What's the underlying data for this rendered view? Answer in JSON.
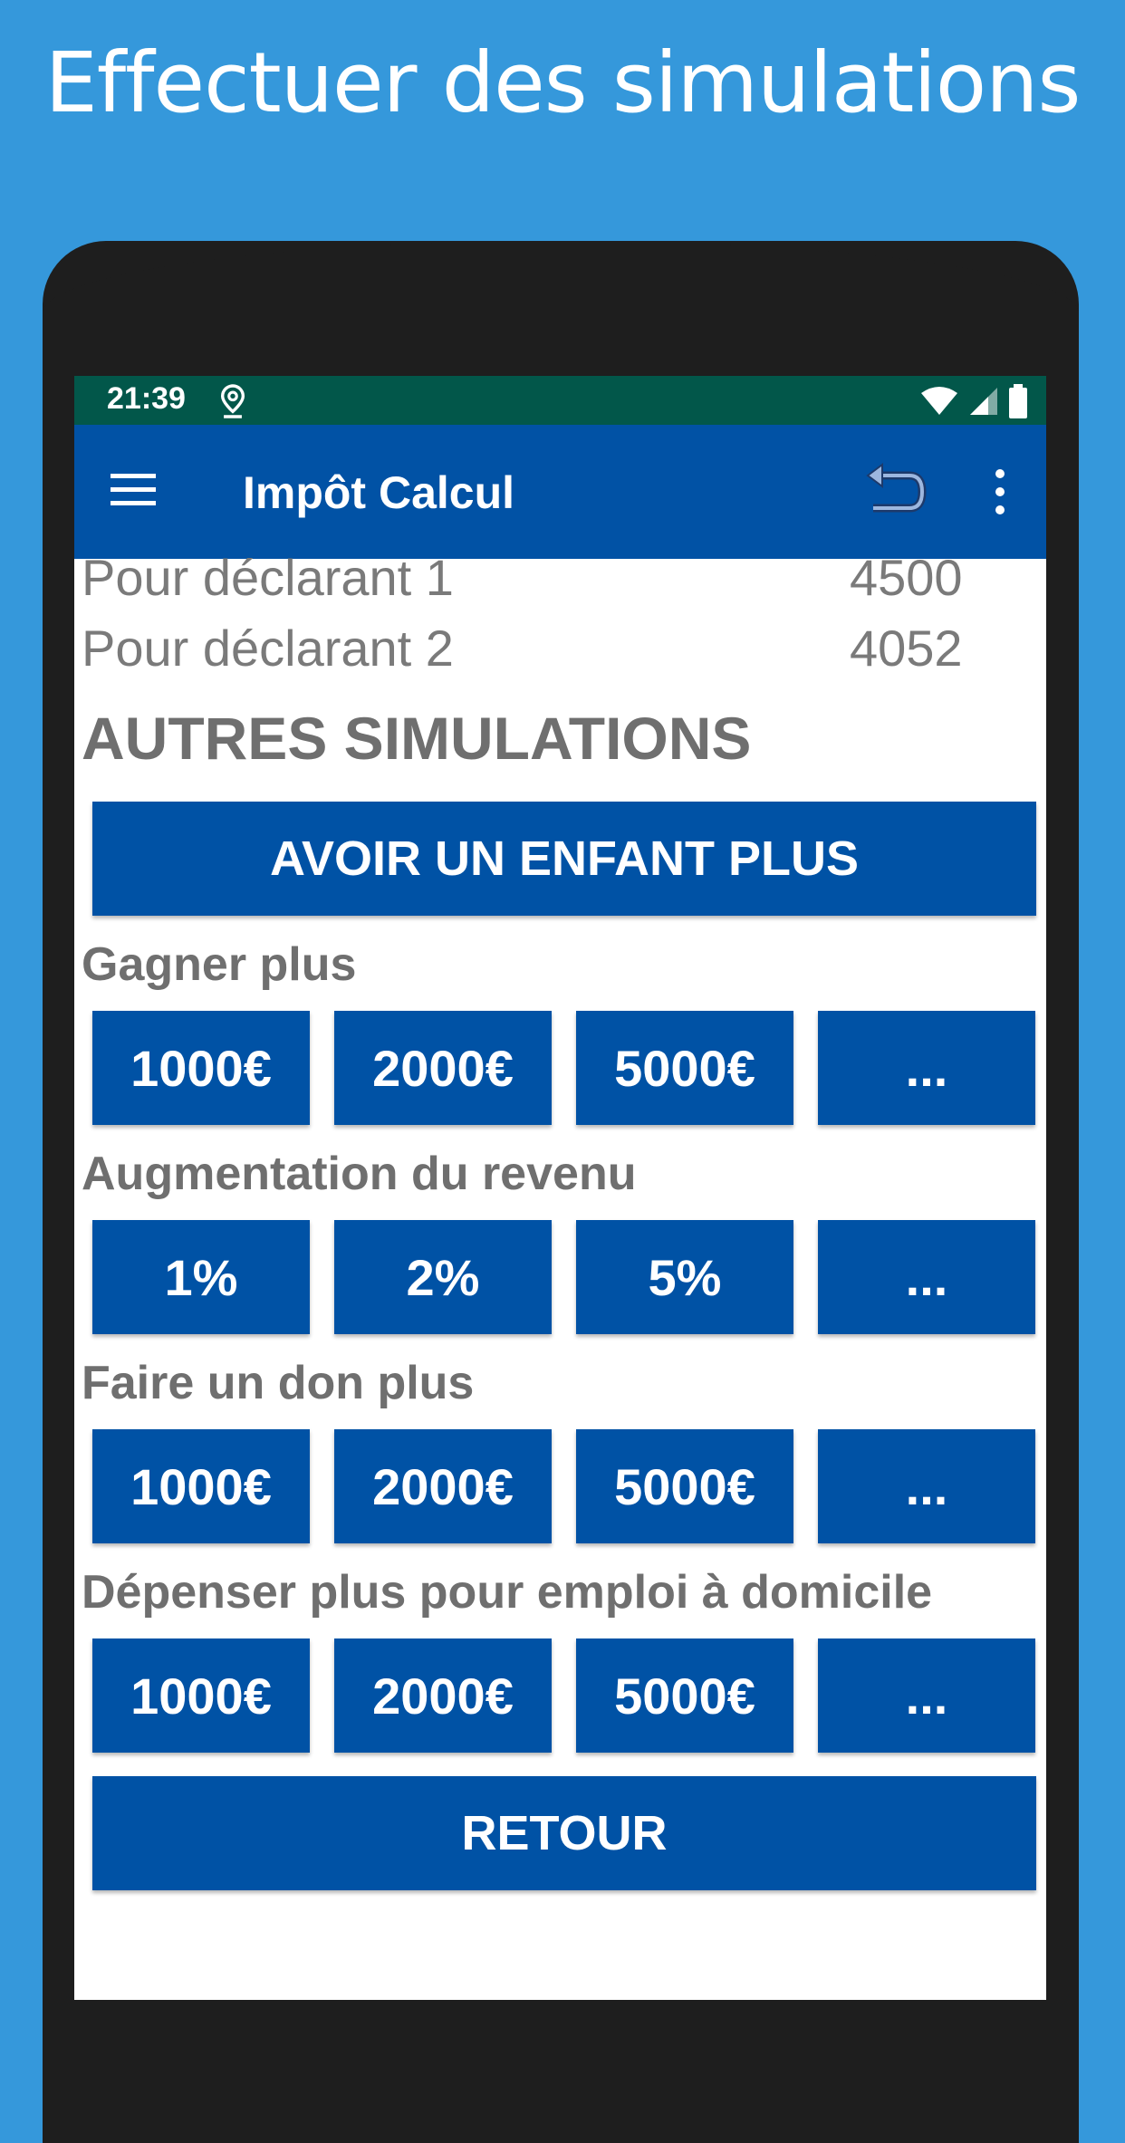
{
  "headline": "Effectuer des simulations",
  "status": {
    "time": "21:39"
  },
  "appbar": {
    "title": "Impôt Calcul"
  },
  "rows": [
    {
      "label": "Pour déclarant 1",
      "value": "4500"
    },
    {
      "label": "Pour déclarant 2",
      "value": "4052"
    }
  ],
  "section_title": "AUTRES SIMULATIONS",
  "enfant_button": "AVOIR UN ENFANT PLUS",
  "groups": [
    {
      "label": "Gagner plus",
      "buttons": [
        "1000€",
        "2000€",
        "5000€",
        "..."
      ]
    },
    {
      "label": "Augmentation du revenu",
      "buttons": [
        "1%",
        "2%",
        "5%",
        "..."
      ]
    },
    {
      "label": "Faire un don plus",
      "buttons": [
        "1000€",
        "2000€",
        "5000€",
        "..."
      ]
    },
    {
      "label": "Dépenser plus pour emploi à domicile",
      "buttons": [
        "1000€",
        "2000€",
        "5000€",
        "..."
      ]
    }
  ],
  "retour_button": "RETOUR",
  "colors": {
    "background": "#3598db",
    "appbar": "#0152a5",
    "statusbar": "#02574a",
    "button": "#0052a5",
    "text_gray": "#6f6f6f"
  }
}
